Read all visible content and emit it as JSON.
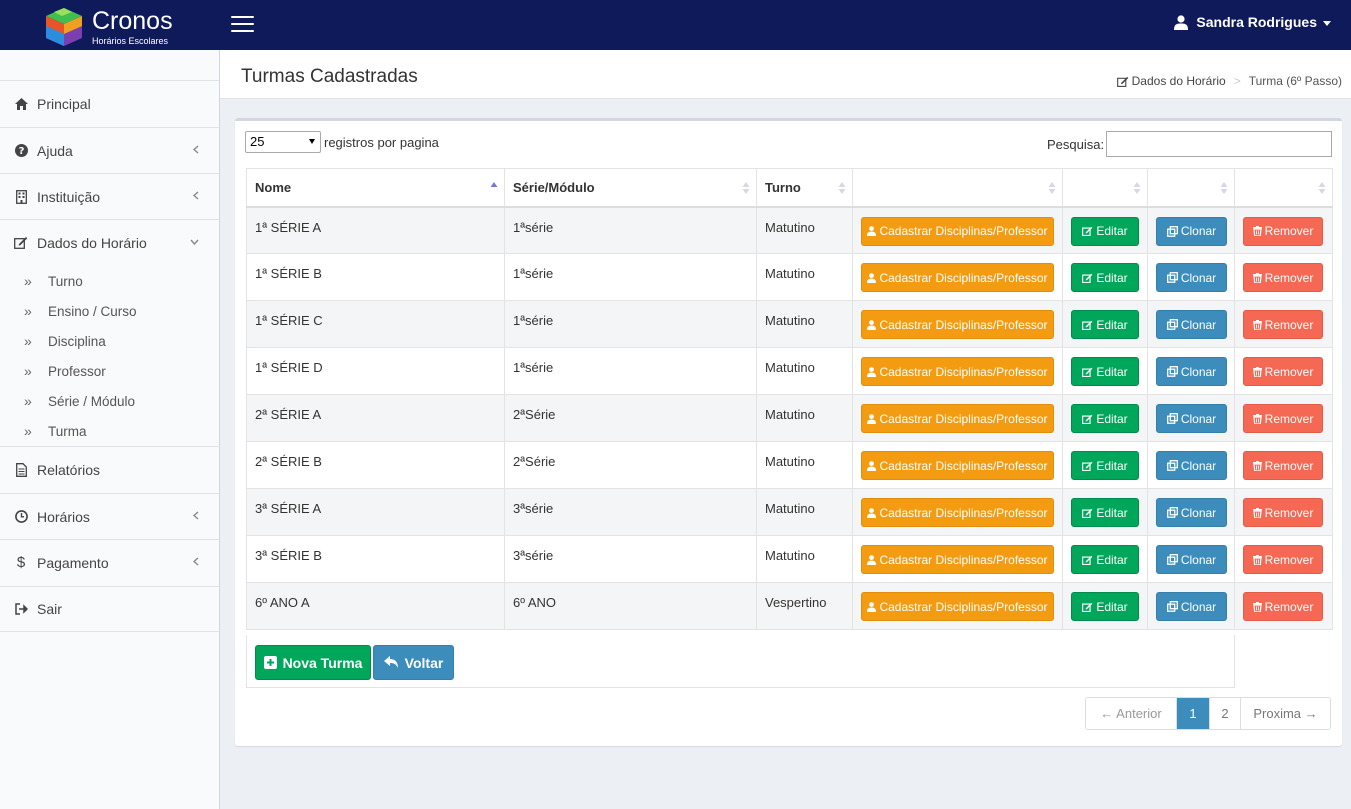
{
  "app": {
    "title": "Cronos",
    "subtitle": "Horários Escolares",
    "user": "Sandra Rodrigues"
  },
  "sidebar": {
    "items": [
      {
        "label": "Principal",
        "icon": "home-icon"
      },
      {
        "label": "Ajuda",
        "icon": "question-circle-icon"
      },
      {
        "label": "Instituição",
        "icon": "building-icon"
      },
      {
        "label": "Dados do Horário",
        "icon": "edit-icon"
      },
      {
        "label": "Relatórios",
        "icon": "file-text-icon"
      },
      {
        "label": "Horários",
        "icon": "clock-icon"
      },
      {
        "label": "Pagamento",
        "icon": "dollar-icon"
      },
      {
        "label": "Sair",
        "icon": "sign-out-icon"
      }
    ],
    "subitems": [
      "Turno",
      "Ensino / Curso",
      "Disciplina",
      "Professor",
      "Série / Módulo",
      "Turma"
    ]
  },
  "header": {
    "title": "Turmas Cadastradas",
    "breadcrumb": [
      "Dados do Horário",
      "Turma (6º Passo)"
    ]
  },
  "table": {
    "length_value": "25",
    "length_label": "registros por pagina",
    "search_label": "Pesquisa:",
    "columns": [
      "Nome",
      "Série/Módulo",
      "Turno",
      "",
      "",
      "",
      ""
    ],
    "rows": [
      {
        "nome": "1ª SÉRIE A",
        "serie": "1ªsérie",
        "turno": "Matutino"
      },
      {
        "nome": "1ª SÉRIE B",
        "serie": "1ªsérie",
        "turno": "Matutino"
      },
      {
        "nome": "1ª SÉRIE C",
        "serie": "1ªsérie",
        "turno": "Matutino"
      },
      {
        "nome": "1ª SÉRIE D",
        "serie": "1ªsérie",
        "turno": "Matutino"
      },
      {
        "nome": "2ª SÉRIE A",
        "serie": "2ªSérie",
        "turno": "Matutino"
      },
      {
        "nome": "2ª SÉRIE B",
        "serie": "2ªSérie",
        "turno": "Matutino"
      },
      {
        "nome": "3ª SÉRIE A",
        "serie": "3ªsérie",
        "turno": "Matutino"
      },
      {
        "nome": "3ª SÉRIE B",
        "serie": "3ªsérie",
        "turno": "Matutino"
      },
      {
        "nome": "6º ANO A",
        "serie": "6º ANO",
        "turno": "Vespertino"
      }
    ],
    "actions": {
      "cadastrar": "Cadastrar Disciplinas/Professor",
      "editar": "Editar",
      "clonar": "Clonar",
      "remover": "Remover"
    }
  },
  "footer": {
    "nova": "Nova Turma",
    "voltar": "Voltar"
  },
  "pagination": {
    "prev": "← Anterior",
    "pages": [
      "1",
      "2"
    ],
    "next": "Proxima →",
    "current": "1"
  },
  "colors": {
    "topbar": "#0f1a5a",
    "warning": "#f39c12",
    "success": "#00a65a",
    "primary": "#3c8dbc",
    "danger": "#f56954"
  }
}
